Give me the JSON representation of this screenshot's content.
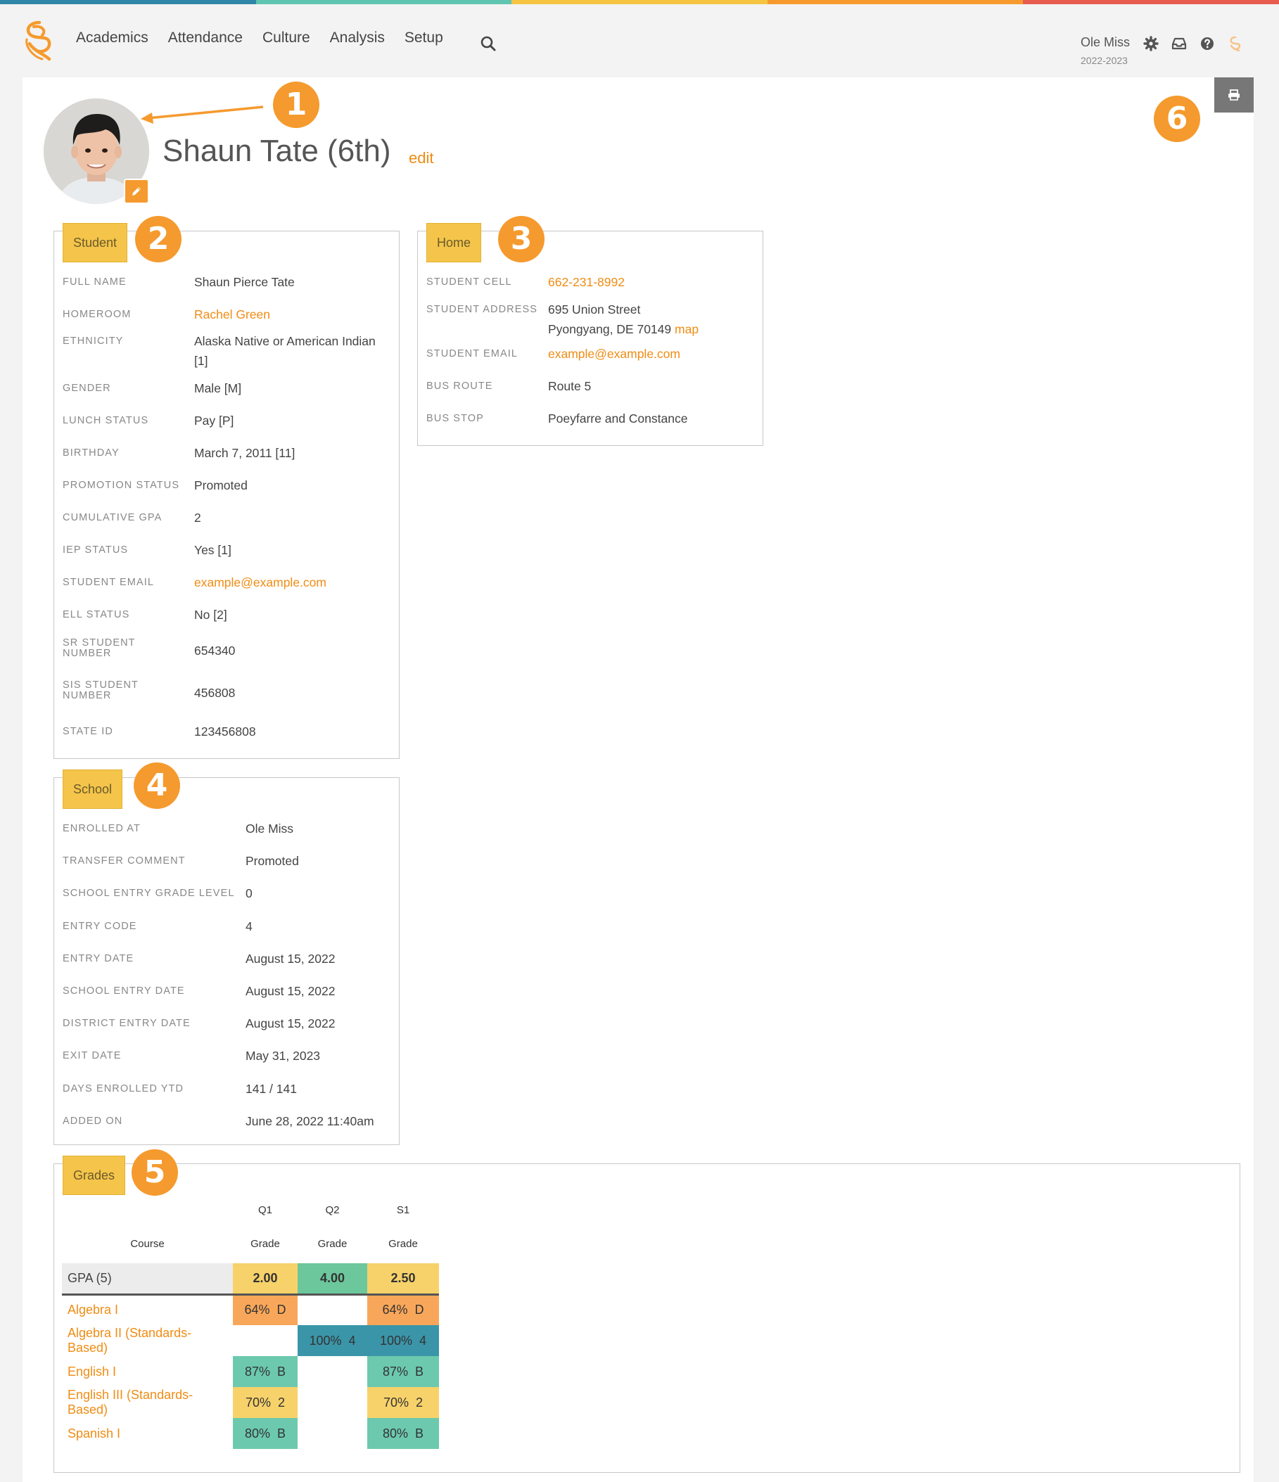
{
  "topbar_colors": [
    "#2f86a6",
    "#5fc4b0",
    "#f5c542",
    "#f79a2e",
    "#e85b4f"
  ],
  "nav": {
    "logo": "swirl-logo",
    "items": [
      "Academics",
      "Attendance",
      "Culture",
      "Analysis",
      "Setup"
    ],
    "search_icon": "search-icon",
    "user_name": "Ole Miss",
    "user_year": "2022-2023",
    "icons": [
      "gear-icon",
      "inbox-icon",
      "help-icon",
      "swirl-logo-icon"
    ]
  },
  "annotations": [
    "1",
    "2",
    "3",
    "4",
    "5",
    "6"
  ],
  "profile": {
    "title": "Shaun Tate (6th)",
    "edit_label": "edit",
    "avatar_edit_icon": "pencil-icon",
    "print_icon": "print-icon"
  },
  "student": {
    "tab": "Student",
    "fields": [
      {
        "label": "FULL NAME",
        "value": "Shaun Pierce Tate",
        "link": false
      },
      {
        "label": "HOMEROOM",
        "value": "Rachel Green",
        "link": true
      },
      {
        "label": "ETHNICITY",
        "value": "Alaska Native or American Indian",
        "value2": "[1]",
        "link": false
      },
      {
        "label": "GENDER",
        "value": "Male [M]",
        "link": false
      },
      {
        "label": "LUNCH STATUS",
        "value": "Pay [P]",
        "link": false
      },
      {
        "label": "BIRTHDAY",
        "value": "March 7, 2011 [11]",
        "link": false
      },
      {
        "label": "PROMOTION STATUS",
        "value": "Promoted",
        "link": false
      },
      {
        "label": "CUMULATIVE GPA",
        "value": "2",
        "link": false
      },
      {
        "label": "IEP STATUS",
        "value": "Yes [1]",
        "link": false
      },
      {
        "label": "STUDENT EMAIL",
        "value": "example@example.com",
        "link": true
      },
      {
        "label": "ELL STATUS",
        "value": "No [2]",
        "link": false
      },
      {
        "label": "SR STUDENT",
        "label2": "NUMBER",
        "value": "654340",
        "link": false
      },
      {
        "label": "SIS STUDENT",
        "label2": "NUMBER",
        "value": "456808",
        "link": false
      },
      {
        "label": "STATE ID",
        "value": "123456808",
        "link": false
      }
    ]
  },
  "home": {
    "tab": "Home",
    "fields": [
      {
        "label": "STUDENT CELL",
        "value": "662-231-8992",
        "link": true
      },
      {
        "label": "STUDENT ADDRESS",
        "value": "695 Union Street",
        "value2": "Pyongyang, DE 70149",
        "map": "map",
        "link": false
      },
      {
        "label": "STUDENT EMAIL",
        "value": "example@example.com",
        "link": true
      },
      {
        "label": "BUS ROUTE",
        "value": "Route 5",
        "link": false
      },
      {
        "label": "BUS STOP",
        "value": "Poeyfarre and Constance",
        "link": false
      }
    ]
  },
  "school": {
    "tab": "School",
    "fields": [
      {
        "label": "ENROLLED AT",
        "value": "Ole Miss"
      },
      {
        "label": "TRANSFER COMMENT",
        "value": "Promoted"
      },
      {
        "label": "SCHOOL ENTRY GRADE LEVEL",
        "value": "0"
      },
      {
        "label": "ENTRY CODE",
        "value": "4"
      },
      {
        "label": "ENTRY DATE",
        "value": "August 15, 2022"
      },
      {
        "label": "SCHOOL ENTRY DATE",
        "value": "August 15, 2022"
      },
      {
        "label": "DISTRICT ENTRY DATE",
        "value": "August 15, 2022"
      },
      {
        "label": "EXIT DATE",
        "value": "May 31, 2023"
      },
      {
        "label": "DAYS ENROLLED YTD",
        "value": "141 / 141"
      },
      {
        "label": "ADDED ON",
        "value": "June 28, 2022 11:40am"
      }
    ]
  },
  "grades": {
    "tab": "Grades",
    "terms": [
      "Q1",
      "Q2",
      "S1"
    ],
    "course_header": "Course",
    "grade_header": "Grade",
    "gpa": {
      "label": "GPA (5)",
      "values": [
        "2.00",
        "4.00",
        "2.50"
      ],
      "colors": [
        "#f7d26a",
        "#6cc79c",
        "#f7d26a"
      ]
    },
    "courses": [
      {
        "name": "Algebra I",
        "cells": [
          {
            "text": "64%  D",
            "color": "#f8a75a"
          },
          null,
          {
            "text": "64%  D",
            "color": "#f8a75a"
          }
        ]
      },
      {
        "name": "Algebra II (Standards-Based)",
        "cells": [
          null,
          {
            "text": "100%  4",
            "color": "#3b95a8"
          },
          {
            "text": "100%  4",
            "color": "#3b95a8"
          }
        ]
      },
      {
        "name": "English I",
        "cells": [
          {
            "text": "87%  B",
            "color": "#6cc9ae"
          },
          null,
          {
            "text": "87%  B",
            "color": "#6cc9ae"
          }
        ]
      },
      {
        "name": "English III (Standards-Based)",
        "cells": [
          {
            "text": "70%  2",
            "color": "#f7d26a"
          },
          null,
          {
            "text": "70%  2",
            "color": "#f7d26a"
          }
        ]
      },
      {
        "name": "Spanish I",
        "cells": [
          {
            "text": "80%  B",
            "color": "#6cc9ae"
          },
          null,
          {
            "text": "80%  B",
            "color": "#6cc9ae"
          }
        ]
      }
    ]
  }
}
